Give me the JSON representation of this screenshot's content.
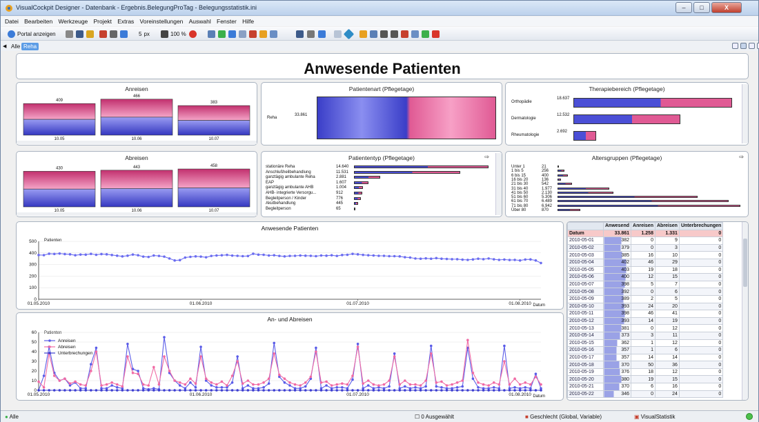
{
  "window": {
    "title": "VisualCockpit Designer - Datenbank - Ergebnis.BelegungProTag - Belegungsstatistik.ini",
    "min": "–",
    "max": "□",
    "close": "X"
  },
  "menu": [
    "Datei",
    "Bearbeiten",
    "Werkzeuge",
    "Projekt",
    "Extras",
    "Voreinstellungen",
    "Auswahl",
    "Fenster",
    "Hilfe"
  ],
  "toolbar": {
    "portal_label": "Portal anzeigen",
    "offset_value": "5",
    "offset_unit": "px",
    "zoom_value": "100 %"
  },
  "tabs": [
    "Alle",
    "Reha"
  ],
  "colors": {
    "blue": "#4b4fd6",
    "pink": "#e05a94",
    "accent": "#5b9ce6"
  },
  "main_title": "Anwesende Patienten",
  "anreisen": {
    "title": "Anreisen",
    "bars": [
      {
        "label": "10.05",
        "value": "409"
      },
      {
        "label": "10.06",
        "value": "466"
      },
      {
        "label": "10.07",
        "value": "383"
      }
    ]
  },
  "abreisen": {
    "title": "Abreisen",
    "bars": [
      {
        "label": "10.05",
        "value": "430"
      },
      {
        "label": "10.06",
        "value": "443"
      },
      {
        "label": "10.07",
        "value": "458"
      }
    ]
  },
  "patientenart": {
    "title": "Patientenart (Pflegetage)",
    "row_label": "Reha",
    "row_value": "33.861"
  },
  "therapie": {
    "title": "Therapiebereich (Pflegetage)",
    "rows": [
      {
        "label": "Orthopädie",
        "value": "18.637",
        "frac": 1.0
      },
      {
        "label": "Dermatologie",
        "value": "12.532",
        "frac": 0.672
      },
      {
        "label": "Rheumatologie",
        "value": "2.692",
        "frac": 0.144
      }
    ]
  },
  "patiententyp": {
    "title": "Patiententyp (Pflegetage)",
    "rows": [
      {
        "label": "stationäre Reha",
        "value": "14.640",
        "frac": 1.0
      },
      {
        "label": "Anschlußheilbehandlung",
        "value": "11.531",
        "frac": 0.788
      },
      {
        "label": "ganztägig ambulante Reha",
        "value": "2.881",
        "frac": 0.197
      },
      {
        "label": "EAP",
        "value": "1.607",
        "frac": 0.11
      },
      {
        "label": "ganztägig ambulante AHB",
        "value": "1.004",
        "frac": 0.069
      },
      {
        "label": "AHB- integrierte Versorgu...",
        "value": "912",
        "frac": 0.062
      },
      {
        "label": "Begleitperson / Kinder",
        "value": "776",
        "frac": 0.053
      },
      {
        "label": "Akutbehandlung",
        "value": "445",
        "frac": 0.03
      },
      {
        "label": "Begleitperson",
        "value": "65",
        "frac": 0.005
      }
    ]
  },
  "alters": {
    "title": "Altersgruppen (Pflegetage)",
    "labels": [
      "Unter 1",
      "1 bis 5",
      "6 bis 15",
      "16 bis 20",
      "21 bis 30",
      "31 bis 40",
      "41 bis 50",
      "51 bis 60",
      "61 bis 70",
      "71 bis 80",
      "Über 80"
    ],
    "values": [
      "21",
      "256",
      "400",
      "136",
      "542",
      "1.977",
      "2.130",
      "5.306",
      "6.489",
      "6.942",
      "870"
    ]
  },
  "chart_data": [
    {
      "type": "line",
      "title": "Anwesende Patienten",
      "ylabel": "Patienten",
      "xlabel": "Datum",
      "ylim": [
        0,
        500
      ],
      "yticks": [
        "500",
        "400",
        "300",
        "200",
        "100",
        "0"
      ],
      "xticks": [
        "01.05.2010",
        "01.06.2010",
        "01.07.2010",
        "01.08.2010"
      ],
      "series": [
        {
          "values": [
            382,
            381,
            393,
            391,
            395,
            390,
            388,
            380,
            386,
            385,
            392,
            384,
            390,
            388,
            382,
            376,
            370,
            376,
            386,
            380,
            368,
            365,
            378,
            374,
            368,
            352,
            335,
            338,
            360,
            366,
            370,
            368,
            362,
            374,
            378,
            380,
            383,
            377,
            375,
            372,
            373,
            393,
            385,
            384,
            378,
            380,
            374,
            370,
            374,
            375,
            378,
            376,
            375,
            372,
            378,
            376,
            380,
            374,
            382,
            384,
            392,
            388,
            383,
            380,
            378,
            375,
            375,
            372,
            372,
            370,
            363,
            360,
            352,
            350,
            353,
            350,
            355,
            350,
            348,
            346,
            346,
            342,
            340,
            344,
            350,
            346,
            352,
            345,
            340,
            343,
            339,
            340,
            335,
            343,
            344,
            335,
            313
          ]
        }
      ]
    },
    {
      "type": "line",
      "title": "An- und Abreisen",
      "ylabel": "Patienten",
      "xlabel": "Datum",
      "ylim": [
        0,
        60
      ],
      "yticks": [
        "60",
        "50",
        "40",
        "30",
        "20",
        "10",
        "0"
      ],
      "xticks": [
        "01.05.2010",
        "01.06.2010",
        "01.07.2010",
        "01.08.2010"
      ],
      "series": [
        {
          "name": "Anreisen",
          "values": [
            0,
            15,
            45,
            18,
            10,
            12,
            5,
            8,
            2,
            2,
            27,
            44,
            2,
            2,
            5,
            3,
            2,
            48,
            22,
            20,
            2,
            1,
            2,
            1,
            55,
            18,
            10,
            5,
            2,
            8,
            3,
            45,
            10,
            5,
            3,
            3,
            3,
            8,
            35,
            2,
            5,
            2,
            2,
            3,
            7,
            49,
            14,
            8,
            5,
            2,
            2,
            4,
            12,
            44,
            2,
            5,
            2,
            3,
            3,
            2,
            11,
            48,
            2,
            5,
            2,
            3,
            2,
            4,
            38,
            2,
            4,
            2,
            3,
            2,
            4,
            46,
            4,
            3,
            2,
            2,
            3,
            4,
            44,
            12,
            3,
            2,
            2,
            3,
            2,
            46,
            2,
            3,
            2,
            3,
            2,
            17,
            2
          ]
        },
        {
          "name": "Abreisen",
          "values": [
            9,
            3,
            38,
            15,
            10,
            12,
            7,
            9,
            6,
            5,
            20,
            40,
            5,
            6,
            8,
            6,
            4,
            35,
            18,
            17,
            6,
            5,
            24,
            6,
            35,
            20,
            10,
            8,
            6,
            12,
            7,
            35,
            12,
            8,
            6,
            9,
            5,
            15,
            30,
            7,
            10,
            6,
            6,
            8,
            12,
            38,
            16,
            12,
            8,
            6,
            5,
            8,
            14,
            40,
            8,
            9,
            5,
            6,
            7,
            6,
            15,
            45,
            7,
            10,
            6,
            5,
            6,
            10,
            35,
            6,
            10,
            6,
            6,
            5,
            10,
            38,
            8,
            9,
            5,
            6,
            8,
            10,
            52,
            18,
            8,
            6,
            5,
            8,
            6,
            30,
            6,
            12,
            6,
            8,
            6,
            14,
            6
          ]
        },
        {
          "name": "Unterbrechungen",
          "values": [
            0,
            0,
            0,
            0,
            0,
            0,
            0,
            0,
            0,
            0,
            0,
            0,
            0,
            0,
            0,
            0,
            0,
            0,
            0,
            0,
            0,
            0,
            0,
            0,
            0,
            0,
            0,
            0,
            0,
            0,
            0,
            0,
            0,
            0,
            0,
            0,
            0,
            0,
            0,
            0,
            0,
            0,
            0,
            0,
            0,
            0,
            0,
            0,
            0,
            0,
            0,
            0,
            0,
            0,
            0,
            0,
            0,
            0,
            0,
            0,
            0,
            0,
            0,
            0,
            0,
            0,
            0,
            0,
            0,
            0,
            0,
            0,
            0,
            0,
            0,
            0,
            0,
            0,
            0,
            0,
            0,
            0,
            0,
            0,
            0,
            0,
            0,
            0,
            0,
            0,
            0,
            0,
            0,
            0,
            0,
            0,
            0
          ]
        }
      ]
    }
  ],
  "table": {
    "headers": [
      "Anwesend",
      "Anreisen",
      "Abreisen",
      "Unterbrechungen"
    ],
    "total": {
      "label": "Datum",
      "values": [
        "33.861",
        "1.258",
        "1.331",
        "0"
      ]
    },
    "rows": [
      [
        "2010-05-01",
        "382",
        "0",
        "9",
        "0"
      ],
      [
        "2010-05-02",
        "379",
        "0",
        "3",
        "0"
      ],
      [
        "2010-05-03",
        "385",
        "16",
        "10",
        "0"
      ],
      [
        "2010-05-04",
        "402",
        "46",
        "29",
        "0"
      ],
      [
        "2010-05-05",
        "403",
        "19",
        "18",
        "0"
      ],
      [
        "2010-05-06",
        "400",
        "12",
        "15",
        "0"
      ],
      [
        "2010-05-07",
        "398",
        "5",
        "7",
        "0"
      ],
      [
        "2010-05-08",
        "392",
        "0",
        "6",
        "0"
      ],
      [
        "2010-05-09",
        "389",
        "2",
        "5",
        "0"
      ],
      [
        "2010-05-10",
        "393",
        "24",
        "20",
        "0"
      ],
      [
        "2010-05-11",
        "398",
        "46",
        "41",
        "0"
      ],
      [
        "2010-05-12",
        "393",
        "14",
        "19",
        "0"
      ],
      [
        "2010-05-13",
        "381",
        "0",
        "12",
        "0"
      ],
      [
        "2010-05-14",
        "373",
        "3",
        "11",
        "0"
      ],
      [
        "2010-05-15",
        "362",
        "1",
        "12",
        "0"
      ],
      [
        "2010-05-16",
        "357",
        "1",
        "6",
        "0"
      ],
      [
        "2010-05-17",
        "357",
        "14",
        "14",
        "0"
      ],
      [
        "2010-05-18",
        "370",
        "50",
        "36",
        "0"
      ],
      [
        "2010-05-19",
        "376",
        "18",
        "12",
        "0"
      ],
      [
        "2010-05-20",
        "380",
        "19",
        "15",
        "0"
      ],
      [
        "2010-05-21",
        "370",
        "6",
        "16",
        "0"
      ],
      [
        "2010-05-22",
        "346",
        "0",
        "24",
        "0"
      ]
    ]
  },
  "status": {
    "filter": "Alle",
    "selected": "0 Ausgewählt",
    "variable": "Geschlecht (Global, Variable)",
    "app": "VisualStatistik"
  }
}
